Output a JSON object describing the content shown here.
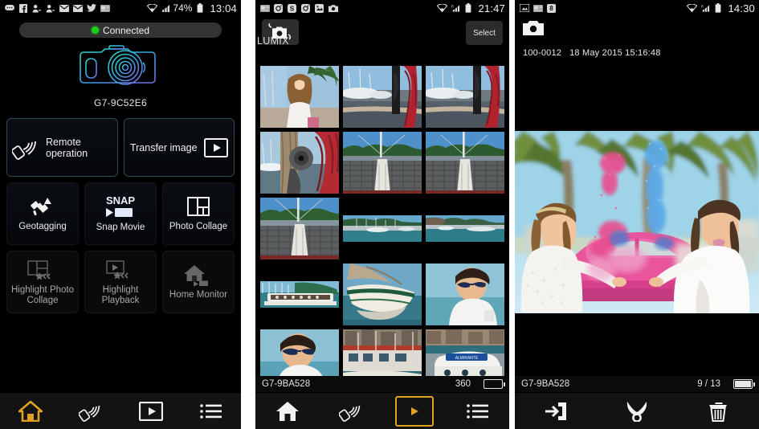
{
  "panels": {
    "home": {
      "status": {
        "icons": [
          "messages-icon",
          "facebook-icon",
          "contact-icon",
          "contact-alt-icon",
          "mail-icon",
          "mail-alt-icon",
          "twitter-icon",
          "news-icon"
        ],
        "wifi": "wifi-icon",
        "signal": "signal-icon",
        "battery_pct": "74%",
        "battery": "battery-icon",
        "time": "13:04"
      },
      "connection": {
        "label": "Connected",
        "dot_color": "#19d219"
      },
      "device_name": "G7-9C52E6",
      "camera_icon": "camera-outline-icon",
      "tiles_big": [
        {
          "label": "Remote operation",
          "icon": "remote-wifi-icon",
          "enabled": true
        },
        {
          "label": "Transfer image",
          "icon": "play-box-icon",
          "enabled": true
        }
      ],
      "tiles_small": [
        {
          "label": "Geotagging",
          "icon": "satellite-icon",
          "enabled": true
        },
        {
          "label": "Snap Movie",
          "icon": "snap-movie-icon",
          "enabled": true
        },
        {
          "label": "Photo Collage",
          "icon": "collage-icon",
          "enabled": true
        },
        {
          "label": "Highlight Photo Collage",
          "icon": "highlight-collage-icon",
          "enabled": false
        },
        {
          "label": "Highlight Playback",
          "icon": "highlight-playback-icon",
          "enabled": false
        },
        {
          "label": "Home Monitor",
          "icon": "home-monitor-icon",
          "enabled": false
        }
      ],
      "nav": [
        {
          "name": "home",
          "icon": "home-icon",
          "active": true
        },
        {
          "name": "remote",
          "icon": "remote-wifi-icon",
          "active": false
        },
        {
          "name": "playback",
          "icon": "play-box-icon",
          "active": false
        },
        {
          "name": "menu",
          "icon": "list-menu-icon",
          "active": false
        }
      ]
    },
    "gallery": {
      "status": {
        "icons": [
          "news-icon",
          "instagram-icon",
          "skype-icon",
          "instagram-alt-icon",
          "photo-sync-icon",
          "camera-small-icon"
        ],
        "wifi": "wifi-icon",
        "roaming": "R",
        "signal": "signal-icon",
        "battery": "battery-icon",
        "time": "21:47"
      },
      "shutter_button": {
        "icon": "camera-rotate-icon"
      },
      "select_button": {
        "label": "Select"
      },
      "folder_label": "LUMIX",
      "thumbnails": [
        {
          "id": "thumb-1",
          "scene": "portrait-woman",
          "selected": false,
          "short": false
        },
        {
          "id": "thumb-2",
          "scene": "rope-winch-boats",
          "selected": false,
          "short": false
        },
        {
          "id": "thumb-3",
          "scene": "rope-winch-boats",
          "selected": false,
          "short": false
        },
        {
          "id": "thumb-4",
          "scene": "pulley-rope",
          "selected": false,
          "short": false
        },
        {
          "id": "thumb-5",
          "scene": "catamaran-deck",
          "selected": false,
          "short": false
        },
        {
          "id": "thumb-6",
          "scene": "catamaran-deck",
          "selected": true,
          "short": false
        },
        {
          "id": "thumb-7",
          "scene": "catamaran-deck",
          "selected": false,
          "short": false
        },
        {
          "id": "thumb-8",
          "scene": "harbour-pano",
          "selected": false,
          "short": true
        },
        {
          "id": "thumb-9",
          "scene": "harbour-pano",
          "selected": false,
          "short": true
        },
        {
          "id": "thumb-10",
          "scene": "boat-crowd",
          "selected": false,
          "short": true
        },
        {
          "id": "thumb-11",
          "scene": "wooden-sailboat",
          "selected": false,
          "short": false
        },
        {
          "id": "thumb-12",
          "scene": "man-sunglasses",
          "selected": false,
          "short": false
        },
        {
          "id": "thumb-13",
          "scene": "man-sunglasses-2",
          "selected": false,
          "short": false
        },
        {
          "id": "thumb-14",
          "scene": "marina-boats",
          "selected": false,
          "short": false
        },
        {
          "id": "thumb-15",
          "scene": "white-blue-boat",
          "selected": false,
          "short": false
        }
      ],
      "info": {
        "device_name": "G7-9BA528",
        "count": "360",
        "battery": "battery-empty-icon"
      },
      "nav": [
        {
          "name": "home",
          "icon": "home-icon",
          "active": false
        },
        {
          "name": "remote",
          "icon": "remote-wifi-icon",
          "active": false
        },
        {
          "name": "playback",
          "icon": "play-box-icon",
          "active": true
        },
        {
          "name": "menu",
          "icon": "list-menu-icon",
          "active": false
        }
      ]
    },
    "viewer": {
      "status": {
        "icons": [
          "screenshot-icon",
          "news-icon",
          "google-plus-icon"
        ],
        "wifi": "wifi-icon",
        "roaming": "R",
        "signal": "signal-icon",
        "battery": "battery-icon",
        "time": "14:30"
      },
      "camera_badge": "camera-small-icon",
      "meta": {
        "file_number": "100-0012",
        "datetime": "18 May 2015 15:16:48"
      },
      "photo": {
        "scene": "holi-powder-girls",
        "alt": "two women throwing coloured powder by a pink car"
      },
      "info": {
        "device_name": "G7-9BA528",
        "position": "9 / 13",
        "battery": "battery-full-icon"
      },
      "nav": [
        {
          "name": "save-to-phone",
          "icon": "save-to-device-icon",
          "active": false
        },
        {
          "name": "share",
          "icon": "share-icon",
          "active": false
        },
        {
          "name": "delete",
          "icon": "trash-icon",
          "active": false
        }
      ]
    }
  },
  "colors": {
    "accent": "#e0a020",
    "connected": "#19d219",
    "selection": "#d99a3c",
    "panel_bg": "#000000",
    "navbar_bg": "#131313"
  }
}
